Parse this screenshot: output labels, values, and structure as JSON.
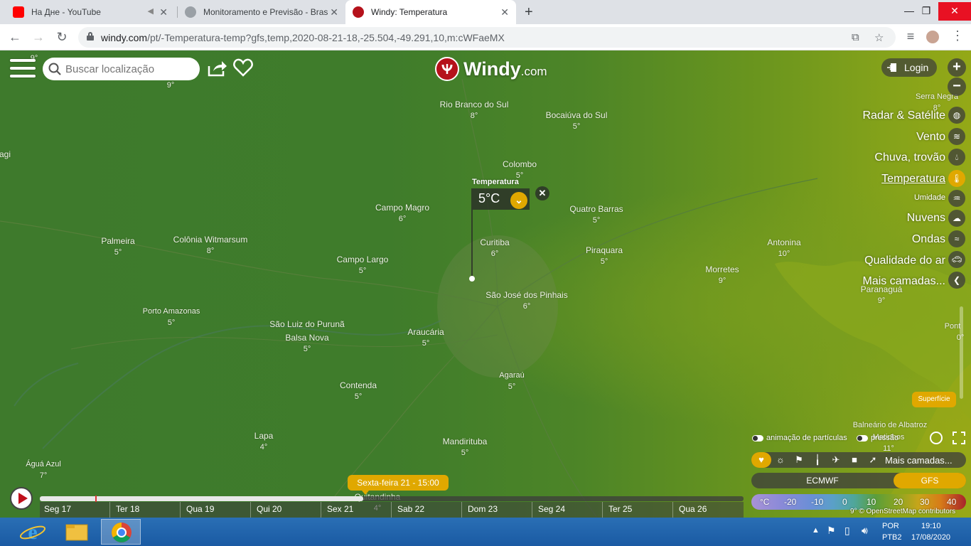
{
  "browser": {
    "tabs": [
      {
        "title": "На Дне - YouTube",
        "favicon_color": "#ff0000"
      },
      {
        "title": "Monitoramento e Previsão - Bras",
        "favicon_color": "#5f6368"
      },
      {
        "title": "Windy: Temperatura",
        "favicon_color": "#b5121b"
      }
    ],
    "url_host": "windy.com",
    "url_path": "/pt/-Temperatura-temp?gfs,temp,2020-08-21-18,-25.504,-49.291,10,m:cWFaeMX"
  },
  "search": {
    "placeholder": "Buscar localização"
  },
  "logo": {
    "name": "Windy",
    "suffix": ".com"
  },
  "login_label": "Login",
  "zoom": {
    "in": "+",
    "out": "−"
  },
  "layers": [
    {
      "label": "Radar & Satélite",
      "icon": "globe-icon"
    },
    {
      "label": "Vento",
      "icon": "wind-icon"
    },
    {
      "label": "Chuva, trovão",
      "icon": "raindrop-icon"
    },
    {
      "label": "Temperatura",
      "icon": "thermometer-icon",
      "active": true
    },
    {
      "label": "Umidade",
      "icon": "humidity-icon"
    },
    {
      "label": "Nuvens",
      "icon": "cloud-icon"
    },
    {
      "label": "Ondas",
      "icon": "waves-icon"
    },
    {
      "label": "Qualidade do ar",
      "icon": "car-icon"
    },
    {
      "label": "Mais camadas...",
      "icon": "chevron-left-icon"
    }
  ],
  "picker": {
    "title": "Temperatura",
    "value": "5°C"
  },
  "cities": [
    {
      "name": "",
      "temp": "9°"
    },
    {
      "name": "",
      "temp": "9°"
    },
    {
      "name": "Rio Branco do Sul",
      "temp": "8°"
    },
    {
      "name": "Bocaiúva do Sul",
      "temp": "5°"
    },
    {
      "name": "Serra Negra",
      "temp": "8°"
    },
    {
      "name": "Colombo",
      "temp": "5°"
    },
    {
      "name": "agi",
      "temp": ""
    },
    {
      "name": "Campo Magro",
      "temp": "6°"
    },
    {
      "name": "Quatro Barras",
      "temp": "5°"
    },
    {
      "name": "Palmeira",
      "temp": "5°"
    },
    {
      "name": "Colônia Witmarsum",
      "temp": "8°"
    },
    {
      "name": "Curitiba",
      "temp": "6°"
    },
    {
      "name": "Antonina",
      "temp": "10°"
    },
    {
      "name": "Piraquara",
      "temp": "5°"
    },
    {
      "name": "Campo Largo",
      "temp": "5°"
    },
    {
      "name": "Morretes",
      "temp": "9°"
    },
    {
      "name": "São José dos Pinhais",
      "temp": "6°"
    },
    {
      "name": "Paranaguá",
      "temp": "9°"
    },
    {
      "name": "Porto Amazonas",
      "temp": "5°"
    },
    {
      "name": "São Luiz do Purunã",
      "temp": ""
    },
    {
      "name": "Balsa Nova",
      "temp": "5°"
    },
    {
      "name": "Araucária",
      "temp": "5°"
    },
    {
      "name": "Pont",
      "temp": "0°"
    },
    {
      "name": "Agaraú",
      "temp": "5°"
    },
    {
      "name": "Contenda",
      "temp": "5°"
    },
    {
      "name": "Balneário de Albatroz",
      "temp": ""
    },
    {
      "name": "Matinhos",
      "temp": "11°"
    },
    {
      "name": "Lapa",
      "temp": "4°"
    },
    {
      "name": "Mandirituba",
      "temp": "5°"
    },
    {
      "name": "Águá Azul",
      "temp": "7°"
    },
    {
      "name": "Quitandinha",
      "temp": "4°"
    }
  ],
  "superficie_label": "Superfície",
  "toggles": {
    "particles": "animação de partículas",
    "pressure": "pressão"
  },
  "overlay_more": "Mais camadas...",
  "overlay_icons": [
    "heart-icon",
    "sun-cloud-icon",
    "flag-icon",
    "thermo-icon",
    "plane-icon",
    "camera-icon",
    "wind-gust-icon"
  ],
  "models": {
    "ecmwf": "ECMWF",
    "gfs": "GFS",
    "active": "GFS"
  },
  "legend": {
    "unit": "°C",
    "values": [
      "-20",
      "-10",
      "0",
      "10",
      "20",
      "30",
      "40"
    ]
  },
  "attribution": "© OpenStreetMap contributors",
  "attribution_temp": "9°",
  "timeline": {
    "current": "Sexta-feira 21 - 15:00",
    "days": [
      "Seg 17",
      "Ter 18",
      "Qua 19",
      "Qui 20",
      "Sex 21",
      "Sab 22",
      "Dom 23",
      "Seg 24",
      "Ter 25",
      "Qua 26"
    ],
    "progress": 0.46
  },
  "taskbar": {
    "lang": "POR",
    "layout": "PTB2",
    "time": "19:10",
    "date": "17/08/2020"
  },
  "colors": {
    "accent": "#e0a800",
    "brand": "#b5121b"
  }
}
